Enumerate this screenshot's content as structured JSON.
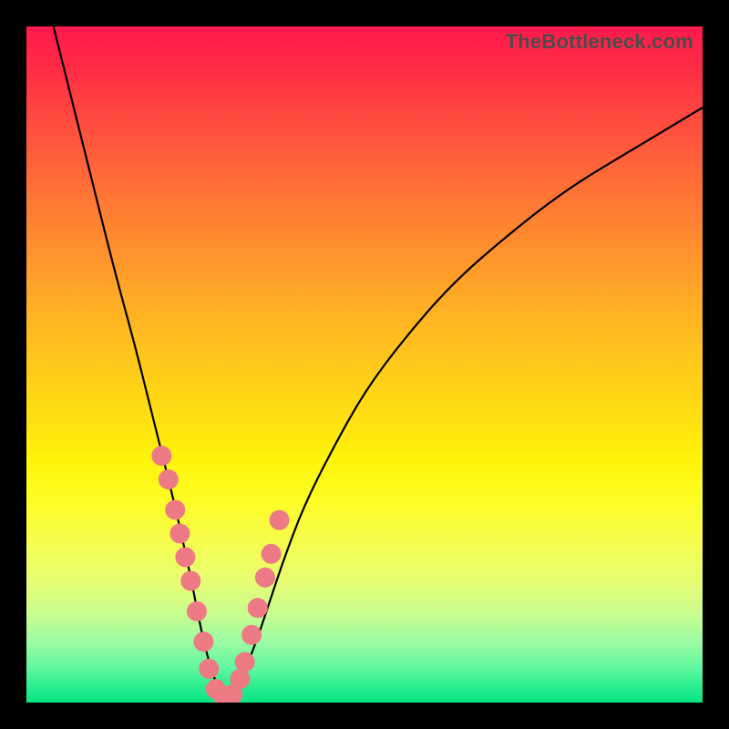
{
  "brand": {
    "watermark": "TheBottleneck.com"
  },
  "colors": {
    "dot": "#ee7a86",
    "line": "#000000",
    "frame": "#000000"
  },
  "chart_data": {
    "type": "line",
    "title": "",
    "xlabel": "",
    "ylabel": "",
    "xlim": [
      0,
      100
    ],
    "ylim": [
      0,
      100
    ],
    "grid": false,
    "legend": false,
    "annotations": [],
    "series": [
      {
        "name": "bottleneck-curve",
        "x": [
          4,
          7,
          10,
          13,
          16,
          18,
          20,
          22,
          24,
          25,
          26,
          27,
          28,
          29,
          30,
          31,
          32,
          34,
          36,
          38,
          41,
          45,
          50,
          56,
          63,
          71,
          80,
          90,
          100
        ],
        "y": [
          100,
          88,
          76,
          64,
          53,
          45,
          37,
          29,
          20,
          15,
          10,
          6,
          3,
          1,
          1,
          2,
          4,
          9,
          15,
          21,
          29,
          37,
          46,
          54,
          62,
          69,
          76,
          82,
          88
        ]
      },
      {
        "name": "highlight-dots",
        "x": [
          20,
          21,
          22,
          22.7,
          23.5,
          24.3,
          25.2,
          26.2,
          27.0,
          28.0,
          29.2,
          30.5,
          31.6,
          32.3,
          33.3,
          34.2,
          35.3,
          36.2,
          37.4
        ],
        "y": [
          36.5,
          33,
          28.5,
          25,
          21.5,
          18,
          13.5,
          9,
          5,
          2,
          0.8,
          1.2,
          3.5,
          6,
          10,
          14,
          18.5,
          22,
          27
        ]
      }
    ]
  }
}
